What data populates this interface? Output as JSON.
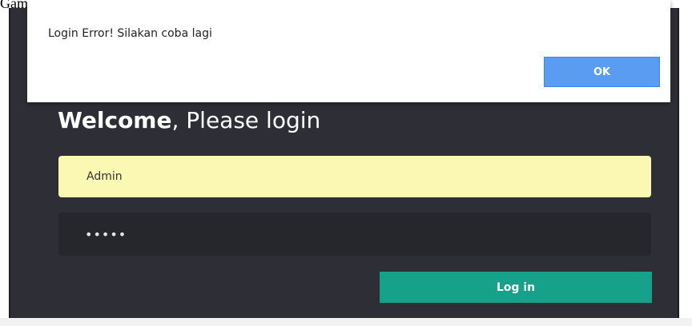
{
  "caption": "Gambar",
  "alert": {
    "message": "Login Error! Silakan coba lagi",
    "ok_label": "OK"
  },
  "login": {
    "welcome_bold": "Welcome",
    "welcome_rest": ", Please login",
    "username_value": "Admin",
    "password_masked": "•••••",
    "login_label": "Log in"
  },
  "colors": {
    "panel_bg": "#2e2f36",
    "autofill_bg": "#fbf8b3",
    "login_button": "#16a28a",
    "ok_button": "#5a9cf2"
  }
}
